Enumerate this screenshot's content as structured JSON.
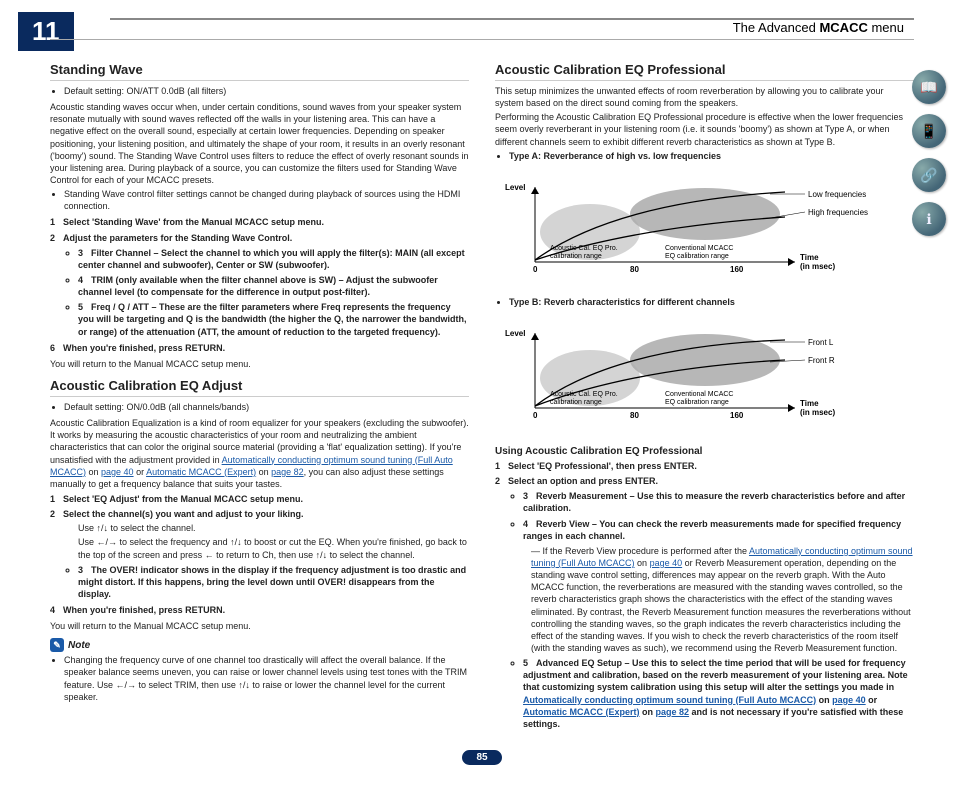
{
  "chapter": "11",
  "breadcrumb_prefix": "The Advanced ",
  "breadcrumb_bold": "MCACC",
  "breadcrumb_suffix": " menu",
  "page_number": "85",
  "left": {
    "h_sw": "Standing Wave",
    "sw_default": "Default setting: ON/ATT 0.0dB (all filters)",
    "sw_p1": "Acoustic standing waves occur when, under certain conditions, sound waves from your speaker system resonate mutually with sound waves reflected off the walls in your listening area. This can have a negative effect on the overall sound, especially at certain lower frequencies. Depending on speaker positioning, your listening position, and ultimately the shape of your room, it results in an overly resonant ('boomy') sound. The Standing Wave Control uses filters to reduce the effect of overly resonant sounds in your listening area. During playback of a source, you can customize the filters used for Standing Wave Control for each of your MCACC presets.",
    "sw_note1": "Standing Wave control filter settings cannot be changed during playback of sources using the HDMI connection.",
    "sw_s1": "Select 'Standing Wave' from the Manual MCACC setup menu.",
    "sw_s2": "Adjust the parameters for the Standing Wave Control.",
    "sw_s2_b1a": "Filter Channel",
    "sw_s2_b1b": " – Select the channel to which you will apply the filter(s): MAIN (all except center channel and subwoofer), Center or SW (subwoofer).",
    "sw_s2_b2a": "TRIM",
    "sw_s2_b2b": " (only available when the filter channel above is SW) – Adjust the subwoofer channel level (to compensate for the difference in output post-filter).",
    "sw_s2_b3a": "Freq / Q / ATT",
    "sw_s2_b3b": " – These are the filter parameters where Freq represents the frequency you will be targeting and Q is the bandwidth (the higher the Q, the narrower the bandwidth, or range) of the attenuation (ATT, the amount of reduction to the targeted frequency).",
    "sw_s3": "When you're finished, press RETURN.",
    "sw_return": "You will return to the Manual MCACC setup menu.",
    "h_eqa": "Acoustic Calibration EQ Adjust",
    "eqa_default": "Default setting: ON/0.0dB (all channels/bands)",
    "eqa_p1a": "Acoustic Calibration Equalization is a kind of room equalizer for your speakers (excluding the subwoofer). It works by measuring the acoustic characteristics of your room and neutralizing the ambient characteristics that can color the original source material (providing a 'flat' equalization setting). If you're unsatisfied with the adjustment provided in ",
    "eqa_link1": "Automatically conducting optimum sound tuning (Full Auto MCACC)",
    "eqa_p1b": " on ",
    "eqa_link2": "page 40",
    "eqa_p1c": " or ",
    "eqa_link3": "Automatic MCACC (Expert)",
    "eqa_p1d": " on ",
    "eqa_link4": "page 82",
    "eqa_p1e": ", you can also adjust these settings manually to get a frequency balance that suits your tastes.",
    "eqa_s1": "Select 'EQ Adjust' from the Manual MCACC setup menu.",
    "eqa_s2": "Select the channel(s) you want and adjust to your liking.",
    "eqa_s2_p1": "Use ↑/↓ to select the channel.",
    "eqa_s2_p2": "Use ←/→ to select the frequency and ↑/↓ to boost or cut the EQ. When you're finished, go back to the top of the screen and press ← to return to Ch, then use ↑/↓ to select the channel.",
    "eqa_s2_b1a": "The OVER! indicator shows in the display if the frequency adjustment is too drastic and might distort. If this happens, bring the level down until OVER! disappears from the display.",
    "eqa_s3": "When you're finished, press RETURN.",
    "eqa_return": "You will return to the Manual MCACC setup menu.",
    "note_label": "Note",
    "note_b1": "Changing the frequency curve of one channel too drastically will affect the overall balance. If the speaker balance seems uneven, you can raise or lower channel levels using test tones with the TRIM feature. Use ←/→ to select TRIM, then use ↑/↓ to raise or lower the channel level for the current speaker."
  },
  "right": {
    "h_pro": "Acoustic Calibration EQ Professional",
    "pro_p1": "This setup minimizes the unwanted effects of room reverberation by allowing you to calibrate your system based on the direct sound coming from the speakers.",
    "pro_p2": "Performing the Acoustic Calibration EQ Professional procedure is effective when the lower frequencies seem overly reverberant in your listening room (i.e. it sounds 'boomy') as shown at Type A, or when different channels seem to exhibit different reverb characteristics as shown at Type B.",
    "type_a": "Type A: Reverberance of high vs. low frequencies",
    "type_b": "Type B: Reverb characteristics for different channels",
    "h_using": "Using Acoustic Calibration EQ Professional",
    "u_s1": "Select 'EQ Professional', then press ENTER.",
    "u_s2": "Select an option and press ENTER.",
    "u_b1a": "Reverb Measurement",
    "u_b1b": " – Use this to measure the reverb characteristics before and after calibration.",
    "u_b2a": "Reverb View",
    "u_b2b": " – You can check the reverb measurements made for specified frequency ranges in each channel.",
    "u_dash_a": "If the Reverb View procedure is performed after the ",
    "u_dash_link1": "Automatically conducting optimum sound tuning (Full Auto MCACC)",
    "u_dash_b": " on ",
    "u_dash_link2": "page 40",
    "u_dash_c": " or Reverb Measurement operation, depending on the standing wave control setting, differences may appear on the reverb graph. With the Auto MCACC function, the reverberations are measured with the standing waves controlled, so the reverb characteristics graph shows the characteristics with the effect of the standing waves eliminated. By contrast, the Reverb Measurement function measures the reverberations without controlling the standing waves, so the graph indicates the reverb characteristics including the effect of the standing waves. If you wish to check the reverb characteristics of the room itself (with the standing waves as such), we recommend using the Reverb Measurement function.",
    "u_b3a": "Advanced EQ Setup",
    "u_b3b": " – Use this to select the time period that will be used for frequency adjustment and calibration, based on the reverb measurement of your listening area. Note that customizing system calibration using this setup will alter the settings you made in ",
    "u_b3_link1": "Automatically conducting optimum sound tuning (Full Auto MCACC)",
    "u_b3c": " on ",
    "u_b3_link2": "page 40",
    "u_b3d": " or ",
    "u_b3_link3": "Automatic MCACC (Expert)",
    "u_b3e": " on ",
    "u_b3_link4": "page 82",
    "u_b3f": " and is not necessary if you're satisfied with these settings."
  },
  "chart_data": [
    {
      "type": "line",
      "title": "Type A: Reverberance of high vs. low frequencies",
      "xlabel": "Time (in msec)",
      "ylabel": "Level",
      "x_ticks": [
        0,
        80,
        160
      ],
      "series": [
        {
          "name": "Low frequencies",
          "shape": "curve rising"
        },
        {
          "name": "High frequencies",
          "shape": "curve rising less"
        }
      ],
      "annotations": [
        "Acoustic Cal. EQ Pro. calibration range",
        "Conventional MCACC EQ calibration range"
      ]
    },
    {
      "type": "line",
      "title": "Type B: Reverb characteristics for different channels",
      "xlabel": "Time (in msec)",
      "ylabel": "Level",
      "x_ticks": [
        0,
        80,
        160
      ],
      "series": [
        {
          "name": "Front L",
          "shape": "curve rising"
        },
        {
          "name": "Front R",
          "shape": "curve rising less"
        }
      ],
      "annotations": [
        "Acoustic Cal. EQ Pro. calibration range",
        "Conventional MCACC EQ calibration range"
      ]
    }
  ]
}
